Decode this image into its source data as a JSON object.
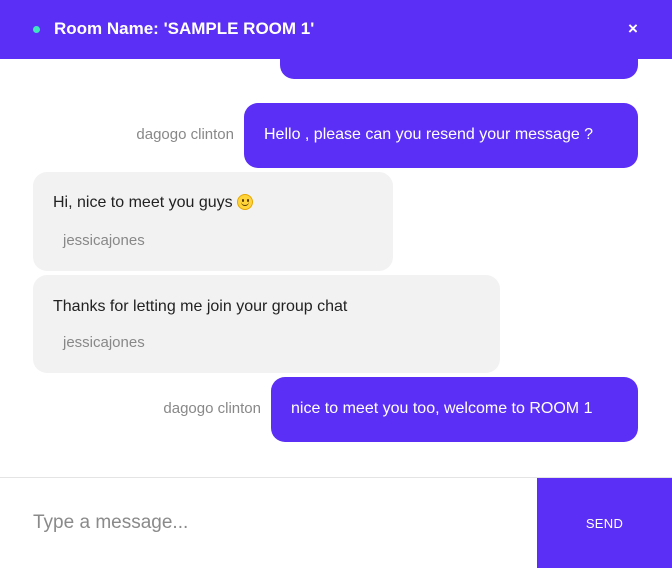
{
  "header": {
    "room_title": "Room Name: 'SAMPLE ROOM 1'",
    "close_label": "×"
  },
  "messages": [
    {
      "direction": "outgoing",
      "sender": "dagogo clinton",
      "text": "Hello , please can you resend your message ?"
    },
    {
      "direction": "incoming",
      "sender": "jessicajones",
      "text": "Hi, nice to meet you guys",
      "emoji": "slightly-smiling-face"
    },
    {
      "direction": "incoming",
      "sender": "jessicajones",
      "text": "Thanks for letting me join your group chat"
    },
    {
      "direction": "outgoing",
      "sender": "dagogo clinton",
      "text": "nice to meet you too, welcome to ROOM 1"
    }
  ],
  "composer": {
    "placeholder": "Type a message...",
    "send_label": "SEND"
  },
  "colors": {
    "accent": "#5b2ff5",
    "online": "#3ee6c0",
    "incoming_bubble": "#f2f2f2"
  }
}
